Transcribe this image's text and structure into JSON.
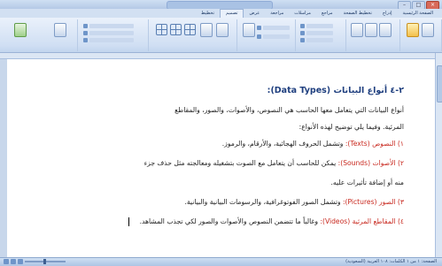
{
  "window": {
    "title": "",
    "controls": [
      "–",
      "□",
      "×"
    ]
  },
  "tabs": [
    "الصفحة الرئيسية",
    "إدراج",
    "تخطيط الصفحة",
    "مراجع",
    "مراسلات",
    "مراجعة",
    "عرض",
    "تصميم",
    "تخطيط"
  ],
  "active_tab_index": 7,
  "document": {
    "heading": "٢-٤ أنواع البيانات (Data Types):",
    "intro_line1": "أنواع البيانات التي يتعامل معها الحاسب هي النصوص، والأصوات، والصور، والمقاطع",
    "intro_line2": "المرئية. وفيما يلي توضيح لهذه الأنواع:",
    "item1_label": "١) النصوص (Texts):",
    "item1_text": " وتشمل الحروف الهجائية، والأرقام، والرموز.",
    "item2_label": "٢) الأصوات (Sounds):",
    "item2_text": " يمكن للحاسب أن يتعامل مع الصوت بتشغيله ومعالجته مثل حذف جزء",
    "item2_line2": "منه أو إضافة تأثيرات عليه.",
    "item3_label": "٣) الصور (Pictures):",
    "item3_text": " وتشمل الصور الفوتوغرافية، والرسومات البيانية والبيانية.",
    "item4_label": "٤) المقاطع المرئية (Videos):",
    "item4_text": " وغالباً ما تتضمن النصوص والأصوات والصور لكي تجذب المشاهد."
  },
  "status": {
    "text": "الصفحة: ١ من ١   الكلمات: ١٠٨   العربية (السعودية)"
  },
  "colors": {
    "accent": "#1f3f7f",
    "highlight": "#c8281e"
  }
}
